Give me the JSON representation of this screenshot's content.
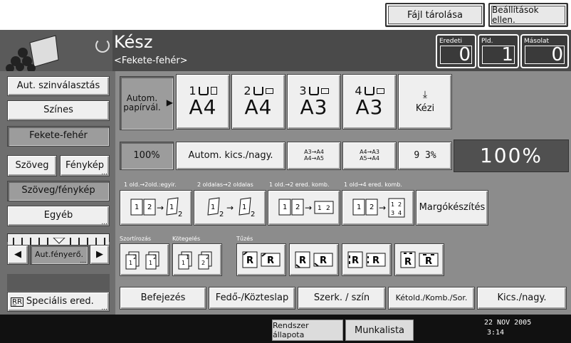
{
  "top": {
    "file_storage": "Fájl tárolása",
    "settings_check": "Beállítások ellen."
  },
  "header": {
    "status": "Kész",
    "mode": "<Fekete-fehér>",
    "counters": [
      {
        "label": "Eredeti",
        "value": "0"
      },
      {
        "label": "Pld.",
        "value": "1"
      },
      {
        "label": "Másolat",
        "value": "0"
      }
    ]
  },
  "side": {
    "auto_color": "Aut. szinválasztás",
    "color": "Színes",
    "bw": "Fekete-fehér",
    "text": "Szöveg",
    "photo": "Fénykép",
    "text_photo": "Szöveg/fénykép",
    "other": "Egyéb",
    "auto_density": "Aut.fényerő.",
    "special": "Speciális ered."
  },
  "paper": {
    "auto_select": "Autom. papírvál.",
    "trays": [
      {
        "num": "1",
        "size": "A4"
      },
      {
        "num": "2",
        "size": "A4"
      },
      {
        "num": "3",
        "size": "A3"
      },
      {
        "num": "4",
        "size": "A3"
      }
    ],
    "manual": "Kézi"
  },
  "ratio": {
    "full": "100%",
    "auto_reduce": "Autom. kics./nagy.",
    "r1_top": "A3→A4",
    "r1_bot": "A4→A5",
    "r2_top": "A4→A3",
    "r2_bot": "A5→A4",
    "r3": "9 3%",
    "display": "100%"
  },
  "duplex": {
    "labels": [
      "1 old.→2old.:egyir.",
      "2 oldalas→2 oldalas",
      "1 old.→2 ered. komb.",
      "1 old→4 ered. komb."
    ],
    "margin": "Margókészítés"
  },
  "finish": {
    "sort": "Szortírozás",
    "stack": "Kötegelés",
    "staple": "Tűzés"
  },
  "tabs": [
    "Befejezés",
    "Fedő-/Közteslap",
    "Szerk. / szín",
    "Kétold./Komb./Sor.",
    "Kics./nagy."
  ],
  "bottom": {
    "system_status": "Rendszer állapota",
    "job_list": "Munkalista",
    "date": "22 NOV 2005",
    "time": "3:14"
  },
  "colors": {
    "header": "#4a4a4a",
    "panel": "#8c8c8c",
    "button": "#efefef"
  }
}
